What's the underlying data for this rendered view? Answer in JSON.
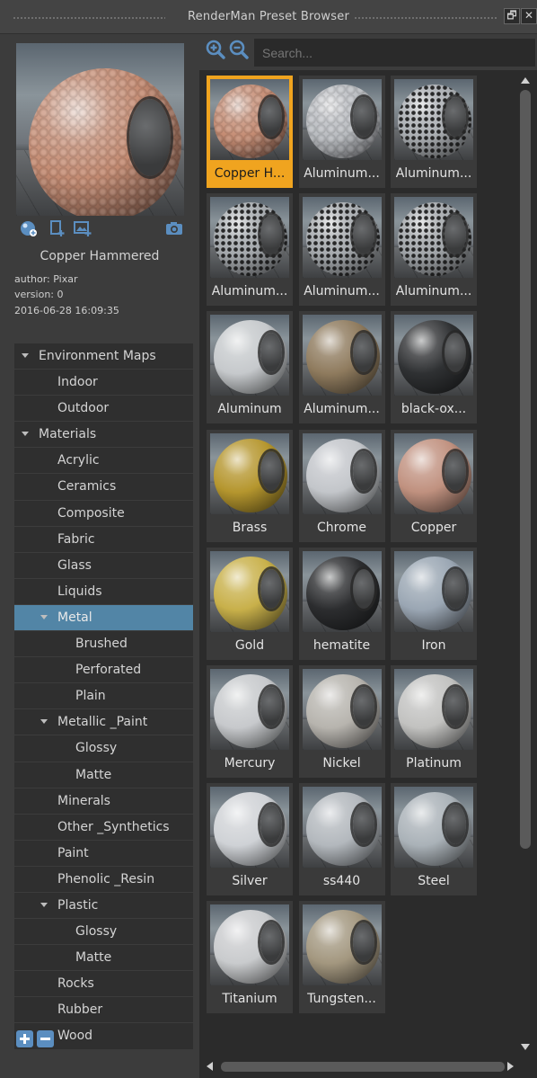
{
  "window": {
    "title": "RenderMan Preset Browser",
    "float_glyph": "🗗",
    "close_glyph": "✕"
  },
  "preview": {
    "name": "Copper Hammered",
    "author": "author: Pixar",
    "version": "version: 0",
    "date": "2016-06-28 16:09:35",
    "icons": [
      "render-preview-icon",
      "add-preset-icon",
      "add-image-icon",
      "camera-icon"
    ]
  },
  "tree": [
    {
      "label": "Environment Maps",
      "level": 0,
      "expanded": true,
      "selected": false
    },
    {
      "label": "Indoor",
      "level": 1,
      "expanded": false,
      "selected": false
    },
    {
      "label": "Outdoor",
      "level": 1,
      "expanded": false,
      "selected": false
    },
    {
      "label": "Materials",
      "level": 0,
      "expanded": true,
      "selected": false
    },
    {
      "label": "Acrylic",
      "level": 1,
      "expanded": false,
      "selected": false
    },
    {
      "label": "Ceramics",
      "level": 1,
      "expanded": false,
      "selected": false
    },
    {
      "label": "Composite",
      "level": 1,
      "expanded": false,
      "selected": false
    },
    {
      "label": "Fabric",
      "level": 1,
      "expanded": false,
      "selected": false
    },
    {
      "label": "Glass",
      "level": 1,
      "expanded": false,
      "selected": false
    },
    {
      "label": "Liquids",
      "level": 1,
      "expanded": false,
      "selected": false
    },
    {
      "label": "Metal",
      "level": 1,
      "expanded": true,
      "selected": true
    },
    {
      "label": "Brushed",
      "level": 2,
      "expanded": false,
      "selected": false
    },
    {
      "label": "Perforated",
      "level": 2,
      "expanded": false,
      "selected": false
    },
    {
      "label": "Plain",
      "level": 2,
      "expanded": false,
      "selected": false
    },
    {
      "label": "Metallic _Paint",
      "level": 1,
      "expanded": true,
      "selected": false
    },
    {
      "label": "Glossy",
      "level": 2,
      "expanded": false,
      "selected": false
    },
    {
      "label": "Matte",
      "level": 2,
      "expanded": false,
      "selected": false
    },
    {
      "label": "Minerals",
      "level": 1,
      "expanded": false,
      "selected": false
    },
    {
      "label": "Other _Synthetics",
      "level": 1,
      "expanded": false,
      "selected": false
    },
    {
      "label": "Paint",
      "level": 1,
      "expanded": false,
      "selected": false
    },
    {
      "label": "Phenolic _Resin",
      "level": 1,
      "expanded": false,
      "selected": false
    },
    {
      "label": "Plastic",
      "level": 1,
      "expanded": true,
      "selected": false
    },
    {
      "label": "Glossy",
      "level": 2,
      "expanded": false,
      "selected": false
    },
    {
      "label": "Matte",
      "level": 2,
      "expanded": false,
      "selected": false
    },
    {
      "label": "Rocks",
      "level": 1,
      "expanded": false,
      "selected": false
    },
    {
      "label": "Rubber",
      "level": 1,
      "expanded": false,
      "selected": false
    },
    {
      "label": "Wood",
      "level": 1,
      "expanded": false,
      "selected": false
    }
  ],
  "search": {
    "placeholder": "Search..."
  },
  "colors": {
    "accent_selected_card": "#f0a41f",
    "accent_selected_tree": "#5285a6",
    "icon_blue": "#5b8ec0"
  },
  "presets": [
    {
      "label": "Copper H...",
      "selected": true,
      "tint": "#c48b72",
      "pattern": "hammered"
    },
    {
      "label": "Aluminum...",
      "selected": false,
      "tint": "#b9bcc0",
      "pattern": "hammered"
    },
    {
      "label": "Aluminum...",
      "selected": false,
      "tint": "#a9adb1",
      "pattern": "perforated"
    },
    {
      "label": "Aluminum...",
      "selected": false,
      "tint": "#a3a7ab",
      "pattern": "perforated"
    },
    {
      "label": "Aluminum...",
      "selected": false,
      "tint": "#a5a9ad",
      "pattern": "perforated"
    },
    {
      "label": "Aluminum...",
      "selected": false,
      "tint": "#a1a5a9",
      "pattern": "perforated"
    },
    {
      "label": "Aluminum",
      "selected": false,
      "tint": "#c6c9cc",
      "pattern": "plain"
    },
    {
      "label": "Aluminum...",
      "selected": false,
      "tint": "#8f7b5e",
      "pattern": "plain"
    },
    {
      "label": "black-ox...",
      "selected": false,
      "tint": "#2f3133",
      "pattern": "plain"
    },
    {
      "label": "Brass",
      "selected": false,
      "tint": "#b5962e",
      "pattern": "plain"
    },
    {
      "label": "Chrome",
      "selected": false,
      "tint": "#c3c6ca",
      "pattern": "plain"
    },
    {
      "label": "Copper",
      "selected": false,
      "tint": "#c0917f",
      "pattern": "plain"
    },
    {
      "label": "Gold",
      "selected": false,
      "tint": "#c8b04a",
      "pattern": "plain"
    },
    {
      "label": "hematite",
      "selected": false,
      "tint": "#2c2d2f",
      "pattern": "plain"
    },
    {
      "label": "Iron",
      "selected": false,
      "tint": "#9aa6b3",
      "pattern": "plain"
    },
    {
      "label": "Mercury",
      "selected": false,
      "tint": "#c7c9cc",
      "pattern": "plain"
    },
    {
      "label": "Nickel",
      "selected": false,
      "tint": "#b7b4ae",
      "pattern": "plain"
    },
    {
      "label": "Platinum",
      "selected": false,
      "tint": "#c2c2c0",
      "pattern": "plain"
    },
    {
      "label": "Silver",
      "selected": false,
      "tint": "#cfd2d6",
      "pattern": "plain"
    },
    {
      "label": "ss440",
      "selected": false,
      "tint": "#b3b8bd",
      "pattern": "plain"
    },
    {
      "label": "Steel",
      "selected": false,
      "tint": "#aab2b8",
      "pattern": "plain"
    },
    {
      "label": "Titanium",
      "selected": false,
      "tint": "#c9cbcd",
      "pattern": "plain"
    },
    {
      "label": "Tungsten...",
      "selected": false,
      "tint": "#a3977f",
      "pattern": "plain"
    }
  ]
}
